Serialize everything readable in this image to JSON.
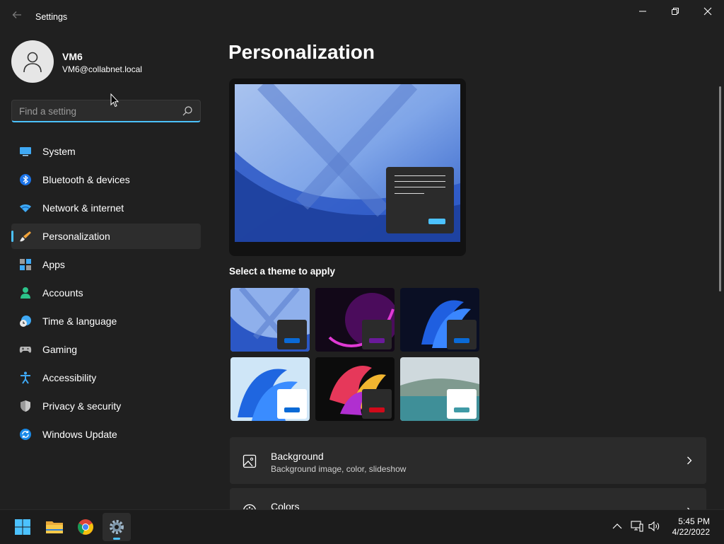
{
  "window": {
    "title": "Settings"
  },
  "user": {
    "name": "VM6",
    "email": "VM6@collabnet.local"
  },
  "search": {
    "placeholder": "Find a setting",
    "value": ""
  },
  "sidebar": {
    "items": [
      {
        "label": "System",
        "icon": "system-icon"
      },
      {
        "label": "Bluetooth & devices",
        "icon": "bluetooth-icon"
      },
      {
        "label": "Network & internet",
        "icon": "wifi-icon"
      },
      {
        "label": "Personalization",
        "icon": "brush-icon",
        "active": true
      },
      {
        "label": "Apps",
        "icon": "apps-icon"
      },
      {
        "label": "Accounts",
        "icon": "accounts-icon"
      },
      {
        "label": "Time & language",
        "icon": "clock-globe-icon"
      },
      {
        "label": "Gaming",
        "icon": "gamepad-icon"
      },
      {
        "label": "Accessibility",
        "icon": "accessibility-icon"
      },
      {
        "label": "Privacy & security",
        "icon": "shield-icon"
      },
      {
        "label": "Windows Update",
        "icon": "update-icon"
      }
    ]
  },
  "main": {
    "title": "Personalization",
    "themes_label": "Select a theme to apply",
    "themes": [
      {
        "name": "windows-light-bloom",
        "accent": "#0a6ad6"
      },
      {
        "name": "glow",
        "accent": "#6a1a9a"
      },
      {
        "name": "windows-dark-bloom",
        "accent": "#0a6ad6"
      },
      {
        "name": "windows-light",
        "accent": "#0a6ad6"
      },
      {
        "name": "captured-motion",
        "accent": "#d10a1a"
      },
      {
        "name": "sunrise",
        "accent": "#3f9aa6"
      }
    ],
    "cards": [
      {
        "title": "Background",
        "subtitle": "Background image, color, slideshow",
        "icon": "image-icon"
      },
      {
        "title": "Colors",
        "subtitle": "",
        "icon": "palette-icon"
      }
    ]
  },
  "taskbar": {
    "time": "5:45 PM",
    "date": "4/22/2022",
    "apps": [
      "start-icon",
      "file-explorer-icon",
      "chrome-icon",
      "settings-icon"
    ]
  },
  "colors": {
    "accent": "#4cc2ff",
    "background": "#202020",
    "card": "#2b2b2b"
  }
}
